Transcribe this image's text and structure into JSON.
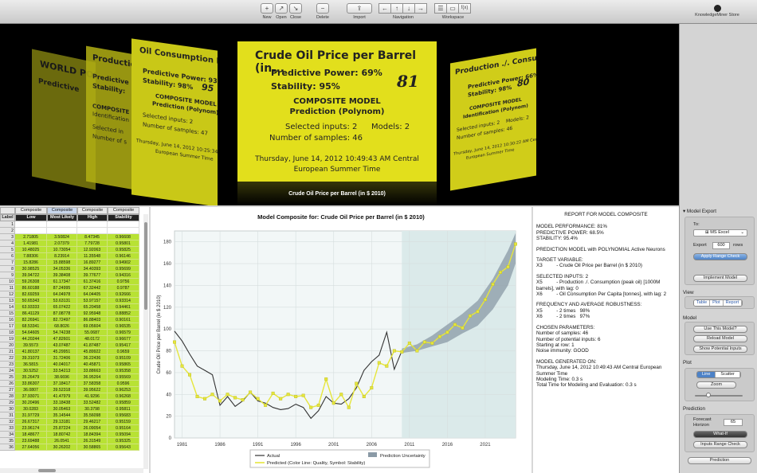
{
  "toolbar": {
    "new": "New",
    "open": "Open",
    "close": "Close",
    "delete": "Delete",
    "import": "Import",
    "navigation": "Navigation",
    "workspace": "Workspace",
    "store": "KnowledgeMiner Store"
  },
  "coverflow": {
    "main": {
      "title": "Crude Oil Price per Barrel (in...",
      "predictive": "Predictive Power: 69%",
      "stability": "Stability: 95%",
      "score": "81",
      "model": "COMPOSITE MODEL",
      "kind": "Prediction (Polynom)",
      "inputs": "Selected inputs: 2",
      "models": "Models: 2",
      "samples": "Number of samples: 46",
      "date1": "Thursday, June 14, 2012 10:49:43 AM Central",
      "date2": "European Summer Time"
    },
    "caption": "Crude Oil Price per Barrel (in $ 2010)",
    "l1": {
      "title": "Oil Consumption Per Capita",
      "pp": "Predictive Power: 93%",
      "st": "Stability: 98%",
      "score": "95",
      "m": "COMPOSITE MODEL",
      "k": "Prediction (Polynom)",
      "si": "Selected inputs: 2",
      "ns": "Number of samples: 47",
      "d": "Thursday, June 14, 2012 10:25:34 AM",
      "d2": "European Summer Time"
    },
    "l2": {
      "title": "Production ./.",
      "pp": "Predictive",
      "st": "Stability:",
      "m": "COMPOSITE",
      "k": "Identification",
      "si": "Selected in",
      "ns": "Number of s"
    },
    "l3": {
      "title": "WORLD POPU",
      "pp": "Predictive"
    },
    "r1": {
      "title": "Production ./. Consumption (pe",
      "pp": "Predictive Power: 66%",
      "st": "Stability: 98%",
      "score": "80",
      "m": "COMPOSITE MODEL",
      "k": "Identification (Polynom)",
      "si": "Selected inputs: 2",
      "md": "Models: 2",
      "ns": "Number of samples: 46",
      "d": "Thursday, June 14, 2012 10:30:22 AM Central",
      "d2": "European Summer Time"
    }
  },
  "table": {
    "groups": [
      "Composite",
      "Composite",
      "Composite",
      "Composite"
    ],
    "columns": [
      "Label",
      "Low",
      "Most Likely",
      "High",
      "Stability"
    ],
    "rows": [
      [
        "1",
        "",
        "",
        "",
        ""
      ],
      [
        "2",
        "",
        "",
        "",
        ""
      ],
      [
        "3",
        "2.71805",
        "3.50824",
        "8.47345",
        "0.96608"
      ],
      [
        "4",
        "1.41981",
        "2.07379",
        "7.79728",
        "0.95801"
      ],
      [
        "5",
        "10.48025",
        "10.73054",
        "12.92063",
        "0.95825"
      ],
      [
        "6",
        "7.88306",
        "8.23914",
        "11.35548",
        "0.96146"
      ],
      [
        "7",
        "15.8286",
        "15.88598",
        "16.89277",
        "0.94902"
      ],
      [
        "8",
        "30.98525",
        "34.05336",
        "34.40393",
        "0.95699"
      ],
      [
        "9",
        "39.94722",
        "39.38408",
        "39.77677",
        "0.94316"
      ],
      [
        "10",
        "59.26308",
        "61.17347",
        "61.37416",
        "0.9756"
      ],
      [
        "11",
        "86.60188",
        "87.24995",
        "67.32442",
        "0.9787"
      ],
      [
        "12",
        "82.69259",
        "64.04978",
        "64.04405",
        "0.92666"
      ],
      [
        "13",
        "50.65343",
        "53.63131",
        "53.97157",
        "0.93314"
      ],
      [
        "14",
        "63.93333",
        "65.07422",
        "65.20458",
        "0.94461"
      ],
      [
        "15",
        "86.41129",
        "87.08778",
        "92.95948",
        "0.88852"
      ],
      [
        "16",
        "82.26941",
        "82.72497",
        "86.88403",
        "0.90161"
      ],
      [
        "17",
        "68.53341",
        "68.8026",
        "69.05604",
        "0.96535"
      ],
      [
        "18",
        "54.64605",
        "54.74238",
        "55.0687",
        "0.96579"
      ],
      [
        "19",
        "44.20244",
        "47.82601",
        "48.0172",
        "0.96677"
      ],
      [
        "20",
        "39.5573",
        "43.07487",
        "41.87487",
        "0.95417"
      ],
      [
        "21",
        "41.80137",
        "45.29951",
        "45.89922",
        "0.9659"
      ],
      [
        "22",
        "39.31073",
        "31.72406",
        "36.22436",
        "0.95109"
      ],
      [
        "23",
        "36.5815",
        "40.04017",
        "40.45871",
        "0.95865"
      ],
      [
        "24",
        "30.5252",
        "33.54213",
        "33.88663",
        "0.95358"
      ],
      [
        "25",
        "35.26479",
        "38.6696",
        "36.95264",
        "0.95569"
      ],
      [
        "26",
        "33.86307",
        "37.18417",
        "37.58358",
        "0.9596"
      ],
      [
        "27",
        "36.0807",
        "39.52318",
        "39.95622",
        "0.96253"
      ],
      [
        "28",
        "37.93071",
        "41.47979",
        "41.9296",
        "0.96268"
      ],
      [
        "29",
        "30.20496",
        "33.18438",
        "33.52482",
        "0.95859"
      ],
      [
        "30",
        "30.0283",
        "30.05463",
        "30.3798",
        "0.95811"
      ],
      [
        "31",
        "31.97729",
        "35.14544",
        "35.56098",
        "0.95683"
      ],
      [
        "32",
        "26.67317",
        "29.13181",
        "29.46217",
        "0.95159"
      ],
      [
        "33",
        "23.96174",
        "25.87224",
        "26.09054",
        "0.95164"
      ],
      [
        "34",
        "18.48677",
        "18.80742",
        "18.84394",
        "0.95094"
      ],
      [
        "35",
        "23.69488",
        "26.0541",
        "26.31549",
        "0.95325"
      ],
      [
        "36",
        "27.64056",
        "30.26202",
        "30.58865",
        "0.95643"
      ]
    ]
  },
  "chart": {
    "title": "Model Composite for:  Crude Oil Price per Barrel (in $ 2010)"
  },
  "chart_data": {
    "type": "line",
    "ylabel": "Crude Oil Price per Barrel (in $ 2010)",
    "xlim": [
      1980,
      2025
    ],
    "ylim": [
      0,
      190
    ],
    "x_ticks": [
      "1981",
      "1986",
      "1991",
      "1996",
      "2001",
      "2006",
      "2011",
      "2016",
      "2021"
    ],
    "y_ticks": [
      "0",
      "20",
      "40",
      "60",
      "80",
      "100",
      "120",
      "140",
      "160",
      "180"
    ],
    "uncertainty_start": 2010,
    "legend": {
      "actual": "Actual",
      "uncertainty": "Prediction Uncertainty",
      "predicted": "Predicted (Color Line: Quality, Symbol: Stability)"
    },
    "series": [
      {
        "name": "Actual",
        "color": "#333333",
        "x": [
          1980,
          1981,
          1982,
          1983,
          1984,
          1985,
          1986,
          1987,
          1988,
          1989,
          1990,
          1991,
          1992,
          1993,
          1994,
          1995,
          1996,
          1997,
          1998,
          1999,
          2000,
          2001,
          2002,
          2003,
          2004,
          2005,
          2006,
          2007,
          2008,
          2009,
          2010
        ],
        "values": [
          98,
          89,
          77,
          66,
          62,
          58,
          30,
          38,
          29,
          34,
          42,
          34,
          32,
          28,
          26,
          27,
          31,
          28,
          18,
          25,
          38,
          32,
          31,
          36,
          46,
          62,
          70,
          76,
          97,
          63,
          80
        ]
      },
      {
        "name": "Predicted",
        "color": "#e6e63c",
        "x": [
          1980,
          1981,
          1982,
          1983,
          1984,
          1985,
          1986,
          1987,
          1988,
          1989,
          1990,
          1991,
          1992,
          1993,
          1994,
          1995,
          1996,
          1997,
          1998,
          1999,
          2000,
          2001,
          2002,
          2003,
          2004,
          2005,
          2006,
          2007,
          2008,
          2009,
          2010,
          2011,
          2012,
          2013,
          2014,
          2015,
          2016,
          2017,
          2018,
          2019,
          2020,
          2021,
          2022,
          2023,
          2024,
          2025
        ],
        "values": [
          88,
          66,
          58,
          38,
          36,
          40,
          34,
          40,
          37,
          35,
          42,
          36,
          30,
          41,
          36,
          40,
          38,
          39,
          28,
          30,
          54,
          32,
          40,
          28,
          50,
          38,
          46,
          69,
          66,
          80,
          79,
          87,
          80,
          88,
          87,
          93,
          97,
          104,
          101,
          112,
          116,
          127,
          141,
          152,
          157,
          178
        ]
      }
    ],
    "band": {
      "x": [
        2010,
        2012,
        2014,
        2016,
        2018,
        2020,
        2022,
        2024,
        2025
      ],
      "low": [
        78,
        80,
        84,
        88,
        96,
        103,
        118,
        140,
        160
      ],
      "high": [
        82,
        86,
        94,
        104,
        114,
        126,
        146,
        172,
        188
      ]
    }
  },
  "report": {
    "title": "REPORT FOR MODEL COMPOSITE",
    "p1": "MODEL PERFORMANCE: 81%\nPREDICTIVE POWER: 68.5%\nSTABILITY: 95.4%",
    "p2": "PREDICTION MODEL with POLYNOMIAL Active Neurons",
    "p3": "TARGET VARIABLE:\nX3          - Crude Oil Price per Barrel (in $ 2010)",
    "p4": "SELECTED INPUTS: 2\nX5          - Production ./. Consumption (peak oil) [1000M\nbarrels], with lag: 0\nX6          - Oil Consumption Per Capita [tonnes], with lag: 2",
    "p5": "FREQUENCY AND AVERAGE ROBUSTNESS:\nX5          - 2 times   98%\nX6          - 2 times   97%",
    "p6": "CHOSEN PARAMETERS:\nNumber of samples: 46\nNumber of potential inputs: 6\nStarting at row: 1\nNoise immunity: GOOD",
    "p7": "MODEL GENERATED ON:\nThursday, June 14, 2012 10:49:43 AM Central European\nSummer Time\nModeling Time: 0.3 s\nTotal Time for Modeling and Evaluation: 0.3 s"
  },
  "panel": {
    "export_title": "Model Export",
    "to": "To:",
    "to_value": "MS Excel",
    "export_label": "Export",
    "export_rows": "600",
    "rows": "rows",
    "apply": "Apply Range Check",
    "implement": "Implement Model",
    "view_title": "View",
    "view_table": "Table",
    "view_plot": "Plot",
    "view_report": "Report",
    "model_title": "Model",
    "use": "Use This Model?",
    "reload": "Reload Model",
    "show": "Show Potential Inputs",
    "plot_title": "Plot",
    "line": "Line",
    "scatter": "Scatter",
    "zoom": "Zoom",
    "pred_title": "Prediction",
    "horizon": "Forecast\nHorizon",
    "horizon_value": "65",
    "whatif": "What-If",
    "inputs_check": "Inputs Range Check",
    "prediction": "Prediction"
  }
}
